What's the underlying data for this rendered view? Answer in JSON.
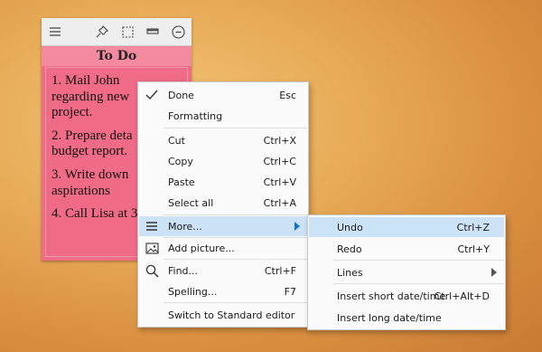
{
  "note": {
    "title": "To Do",
    "lines": [
      [
        "1. Mail John",
        "regarding new",
        "project."
      ],
      [
        "2. Prepare deta",
        "budget report."
      ],
      [
        "3. Write down",
        "aspirations"
      ],
      [
        "4. Call Lisa at 3"
      ]
    ],
    "toolbar_icons": [
      "menu-icon",
      "pin-icon",
      "select-icon",
      "minimize-icon",
      "close-icon"
    ],
    "color": "#ef6b86"
  },
  "context_menu": {
    "items": [
      {
        "label": "Done",
        "shortcut": "Esc",
        "icon": "checkmark-icon"
      },
      {
        "label": "Formatting",
        "shortcut": ""
      },
      {
        "label": "Cut",
        "shortcut": "Ctrl+X"
      },
      {
        "label": "Copy",
        "shortcut": "Ctrl+C"
      },
      {
        "label": "Paste",
        "shortcut": "Ctrl+V"
      },
      {
        "label": "Select all",
        "shortcut": "Ctrl+A"
      },
      {
        "label": "More...",
        "shortcut": "",
        "icon": "more-icon",
        "highlighted": true
      },
      {
        "label": "Add picture...",
        "shortcut": "",
        "icon": "picture-icon"
      },
      {
        "label": "Find...",
        "shortcut": "Ctrl+F",
        "icon": "search-icon"
      },
      {
        "label": "Spelling...",
        "shortcut": "F7"
      },
      {
        "label": "Switch to Standard editor",
        "shortcut": ""
      }
    ]
  },
  "submenu": {
    "items": [
      {
        "label": "Undo",
        "shortcut": "Ctrl+Z",
        "highlighted": true
      },
      {
        "label": "Redo",
        "shortcut": "Ctrl+Y"
      },
      {
        "label": "Lines",
        "shortcut": ""
      },
      {
        "label": "Insert short date/time",
        "shortcut": "Ctrl+Alt+D"
      },
      {
        "label": "Insert long date/time",
        "shortcut": ""
      }
    ]
  },
  "colors": {
    "highlight": "#cce2f7",
    "arrow": "#1a73c8"
  }
}
